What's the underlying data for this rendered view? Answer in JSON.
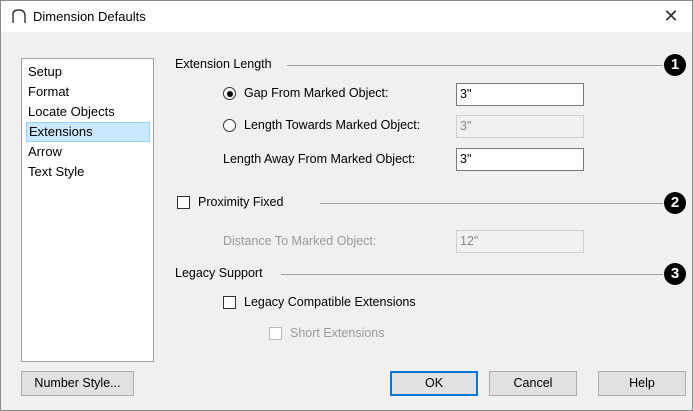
{
  "window": {
    "title": "Dimension Defaults",
    "close_glyph": "✕"
  },
  "sidebar": {
    "items": [
      {
        "label": "Setup"
      },
      {
        "label": "Format"
      },
      {
        "label": "Locate Objects"
      },
      {
        "label": "Extensions",
        "selected": true
      },
      {
        "label": "Arrow"
      },
      {
        "label": "Text Style"
      }
    ]
  },
  "extension_length": {
    "title": "Extension Length",
    "badge": "1",
    "gap_label": "Gap From Marked Object:",
    "gap_value": "3\"",
    "gap_selected": true,
    "towards_label": "Length Towards Marked Object:",
    "towards_value": "3\"",
    "towards_selected": false,
    "away_label": "Length Away From Marked Object:",
    "away_value": "3\""
  },
  "proximity": {
    "title": "Proximity Fixed",
    "checked": false,
    "badge": "2",
    "distance_label": "Distance To Marked Object:",
    "distance_value": "12\""
  },
  "legacy": {
    "title": "Legacy Support",
    "badge": "3",
    "compatible_label": "Legacy Compatible Extensions",
    "compatible_checked": false,
    "short_label": "Short Extensions",
    "short_checked": false
  },
  "buttons": {
    "number_style": "Number Style...",
    "ok": "OK",
    "cancel": "Cancel",
    "help": "Help"
  },
  "colors": {
    "selection": "#cce8ff",
    "default_button_border": "#0078d7"
  }
}
